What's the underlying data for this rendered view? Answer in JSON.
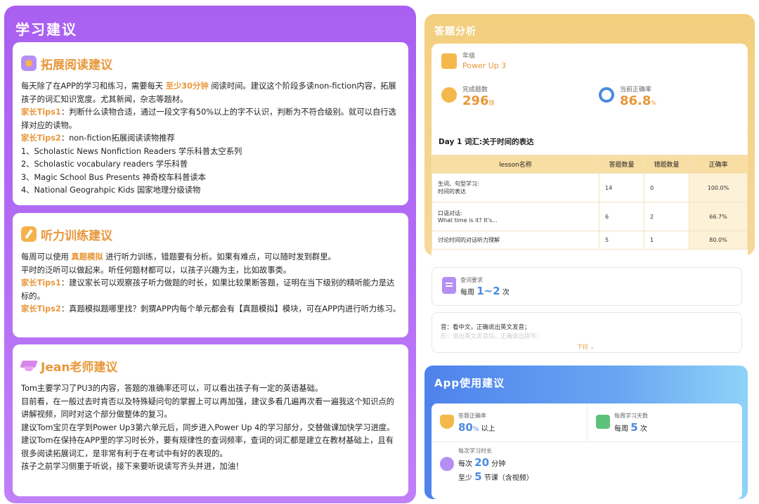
{
  "left": {
    "title": "学习建议",
    "reading": {
      "heading": "拓展阅读建议",
      "p1_a": "每天除了在APP的学习和练习，需要每天",
      "p1_hl": "至少30分钟",
      "p1_b": "阅读时间。建议这个阶段多读non-fiction内容，拓展孩子的词汇知识宽度。尤其新闻，杂志等题材。",
      "tip1_label": "家长Tips1",
      "tip1_text": "：判断什么读物合适，通过一段文字有50%以上的字不认识，判断为不符合级别。就可以自行选择对应的读物。",
      "tip2_label": "家长Tips2",
      "tip2_text": "：non-fiction拓展阅读读物推荐",
      "list": [
        "1、Scholastic News Nonfiction Readers 学乐科普太空系列",
        "2、Scholastic vocabulary readers 学乐科普",
        "3、Magic School Bus Presents 神奇校车科普读本",
        "4、National Geograhpic Kids  国家地理分级读物"
      ]
    },
    "listening": {
      "heading": "听力训练建议",
      "p1_a": "每周可以使用",
      "p1_hl": "真题模拟",
      "p1_b": "进行听力训练，错题要有分析。如果有难点，可以随时发到群里。",
      "p2": "平时的泛听可以做起来。听任何题材都可以，以孩子兴趣为主，比如故事类。",
      "tip1_label": "家长Tips1",
      "tip1_text": "：建议家长可以观察孩子听力做题的时长，如果比较果断答题，证明在当下级别的精听能力是达标的。",
      "tip2_label": "家长Tips2",
      "tip2_text": "：真题模拟题哪里找？刺猬APP内每个单元都会有【真题模拟】模块，可在APP内进行听力练习。"
    },
    "teacher": {
      "heading": "Jean老师建议",
      "p1": "Tom主要学习了PU3的内容，答题的准确率还可以，可以看出孩子有一定的英语基础。",
      "p2": "目前看，在一般过去时肯否以及特殊疑问句的掌握上可以再加强，建议多看几遍再次看一遍我这个知识点的讲解视频，同时对这个部分做整体的复习。",
      "p3": "建议Tom宝贝在学到Power Up3第六单元后，同步进入Power Up 4的学习部分，交替做课加快学习进度。",
      "p4": "建议Tom在保持在APP里的学习时长外，要有规律性的查词频率，查词的词汇都是建立在教材基础上，且有很多阅读拓展词汇，是非常有利于在考试中有好的表现的。",
      "p5": "孩子之前学习侧重于听说，接下来要听说读写齐头并进，加油！"
    }
  },
  "analysis": {
    "title": "答题分析",
    "grade_label": "年级",
    "grade_value": "Power Up 3",
    "done_label": "完成题数",
    "done_value": "296",
    "done_unit": "题",
    "acc_label": "当前正确率",
    "acc_value": "86.8",
    "acc_unit": "%",
    "day_title": "Day 1 词汇:关于时间的表达",
    "columns": [
      "lesson名称",
      "答题数量",
      "错题数量",
      "正确率"
    ],
    "rows": [
      {
        "name1": "生词、句型学习:",
        "name2": "时间的表达",
        "answered": "14",
        "wrong": "0",
        "accuracy": "100.0%"
      },
      {
        "name1": "口语对话:",
        "name2": "What time is it? It's...",
        "answered": "6",
        "wrong": "2",
        "accuracy": "66.7%"
      },
      {
        "name1": "讨论时间的对话听力理解",
        "name2": "",
        "answered": "5",
        "wrong": "1",
        "accuracy": "80.0%"
      }
    ]
  },
  "lookup": {
    "label": "查词要求",
    "prefix": "每周",
    "value": "1~2",
    "suffix": "次",
    "line1": "音：看中文，正确说出英文发音；",
    "line2": "形：说出英文发音后，正确说出拼写；",
    "more": "下拉"
  },
  "app": {
    "title": "App使用建议",
    "acc_label": "答题正确率",
    "acc_value": "80",
    "acc_unit": "%",
    "acc_suffix": "以上",
    "days_label": "每周学习天数",
    "days_prefix": "每周",
    "days_value": "5",
    "days_suffix": "次",
    "time_label": "每次学习时长",
    "time_prefix": "每次",
    "time_value": "20",
    "time_suffix": "分钟",
    "lesson_prefix": "至少",
    "lesson_value": "5",
    "lesson_suffix": "节课（含视频）"
  },
  "colors": {
    "purple": "#b36cf5",
    "orange": "#e8973a",
    "gold": "#f3cf7e",
    "blue": "#4a8be0"
  }
}
